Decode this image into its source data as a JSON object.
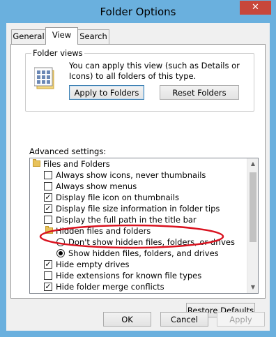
{
  "window": {
    "title": "Folder Options",
    "close_glyph": "✕"
  },
  "tabs": [
    {
      "label": "General"
    },
    {
      "label": "View"
    },
    {
      "label": "Search"
    }
  ],
  "folder_views": {
    "group_label": "Folder views",
    "description": "You can apply this view (such as Details or Icons) to all folders of this type.",
    "apply_button": "Apply to Folders",
    "reset_button": "Reset Folders"
  },
  "advanced": {
    "label": "Advanced settings:",
    "items": [
      {
        "type": "folder",
        "label": "Files and Folders"
      },
      {
        "type": "checkbox",
        "checked": false,
        "label": "Always show icons, never thumbnails"
      },
      {
        "type": "checkbox",
        "checked": false,
        "label": "Always show menus"
      },
      {
        "type": "checkbox",
        "checked": true,
        "label": "Display file icon on thumbnails"
      },
      {
        "type": "checkbox",
        "checked": true,
        "label": "Display file size information in folder tips"
      },
      {
        "type": "checkbox",
        "checked": false,
        "label": "Display the full path in the title bar"
      },
      {
        "type": "folder",
        "label": "Hidden files and folders"
      },
      {
        "type": "radio",
        "checked": false,
        "label": "Don't show hidden files, folders, or drives"
      },
      {
        "type": "radio",
        "checked": true,
        "label": "Show hidden files, folders, and drives"
      },
      {
        "type": "checkbox",
        "checked": true,
        "label": "Hide empty drives"
      },
      {
        "type": "checkbox",
        "checked": false,
        "label": "Hide extensions for known file types"
      },
      {
        "type": "checkbox",
        "checked": true,
        "label": "Hide folder merge conflicts"
      }
    ]
  },
  "restore_button": "Restore Defaults",
  "dialog_buttons": {
    "ok": "OK",
    "cancel": "Cancel",
    "apply": "Apply"
  },
  "colors": {
    "annotation": "#d9121f",
    "titlebar": "#6ab0de",
    "close": "#c7473b"
  }
}
